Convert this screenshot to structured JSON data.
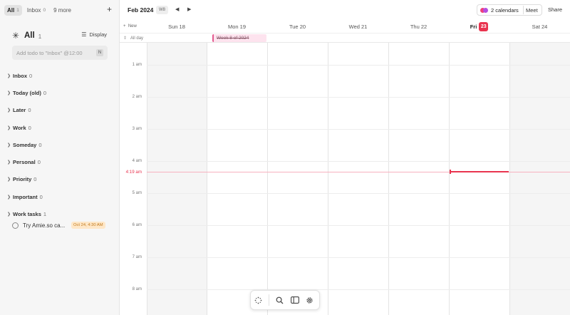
{
  "sidebar": {
    "tabs": [
      {
        "label": "All",
        "count": "1"
      },
      {
        "label": "Inbox",
        "count": "0"
      },
      {
        "label": "9 more"
      }
    ],
    "add_icon": "plus-icon",
    "header": {
      "icon": "sparkle-icon",
      "title": "All",
      "count": "1",
      "display_label": "Display",
      "display_icon": "sliders-icon"
    },
    "input": {
      "placeholder": "Add todo to \"Inbox\" @12:00",
      "shortcut": "N"
    },
    "groups": [
      {
        "name": "Inbox",
        "count": "0"
      },
      {
        "name": "Today (old)",
        "count": "0"
      },
      {
        "name": "Later",
        "count": "0"
      },
      {
        "name": "Work",
        "count": "0"
      },
      {
        "name": "Someday",
        "count": "0"
      },
      {
        "name": "Personal",
        "count": "0"
      },
      {
        "name": "Priority",
        "count": "0"
      },
      {
        "name": "Important",
        "count": "0"
      },
      {
        "name": "Work tasks",
        "count": "1"
      }
    ],
    "task": {
      "text": "Try Amie.so ca...",
      "date": "Oct 24, 4:30 AM"
    }
  },
  "topbar": {
    "month": "Feb 2024",
    "week": "W8",
    "calendars_label": "2 calendars",
    "meet_label": "Meet",
    "share_label": "Share"
  },
  "calendar": {
    "new_label": "New",
    "allday_label": "All day",
    "days": [
      {
        "name": "Sun",
        "num": "18"
      },
      {
        "name": "Mon",
        "num": "19"
      },
      {
        "name": "Tue",
        "num": "20"
      },
      {
        "name": "Wed",
        "num": "21"
      },
      {
        "name": "Thu",
        "num": "22"
      },
      {
        "name": "Fri",
        "num": "23",
        "today": true
      },
      {
        "name": "Sat",
        "num": "24"
      }
    ],
    "allday_event": "Week 8 of 2024",
    "hours": [
      "1 am",
      "2 am",
      "3 am",
      "4 am",
      "5 am",
      "6 am",
      "7 am",
      "8 am"
    ],
    "now_label": "4:19 am"
  },
  "colors": {
    "accent": "#e9344f",
    "calendar_pink": "#f0407a",
    "calendar_purple": "#b44fe0",
    "event_bg": "#fde3ee"
  },
  "toolbar": {
    "icons": [
      "sparkle-icon",
      "search-icon",
      "sidebar-icon",
      "gear-icon"
    ]
  }
}
